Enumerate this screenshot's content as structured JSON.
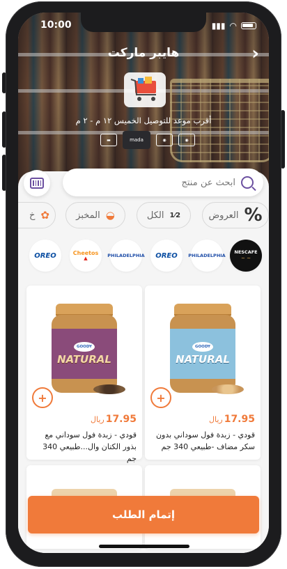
{
  "status_bar": {
    "time": "10:00"
  },
  "header": {
    "title": "هايبر ماركت",
    "back_icon": "chevron-right-icon",
    "delivery_text": "أقرب موعد للتوصيل الخميس ١٢ م - ٢ م",
    "payment_methods": [
      "card-icon",
      "mada-icon",
      "cash-icon",
      "cash-icon"
    ]
  },
  "search": {
    "placeholder": "ابحث عن منتج"
  },
  "categories": [
    {
      "label": "العروض",
      "icon": "percent-icon"
    },
    {
      "label": "الكل",
      "icon": "all-icon"
    },
    {
      "label": "المخبز",
      "icon": "bread-icon"
    },
    {
      "label": "خ",
      "icon": "produce-icon"
    }
  ],
  "brands": [
    "NESCAFE",
    "PHILADELPHIA",
    "OREO",
    "PHILADELPHIA",
    "Cheetos",
    "OREO"
  ],
  "products": [
    {
      "name": "قودي - زبدة فول سوداني بدون سكر مضاف -طبيعي 340 جم",
      "price": "17.95",
      "currency": "ريال",
      "label_text": "NATURAL",
      "brand": "GOODY"
    },
    {
      "name": "قودي - زبدة فول سوداني مع بذور الكتان وال...طبيعي 340 جم",
      "price": "17.95",
      "currency": "ريال",
      "label_text": "NATURAL",
      "brand": "GOODY"
    }
  ],
  "checkout": {
    "label": "إتمام الطلب"
  },
  "colors": {
    "accent": "#f07a3a",
    "brand_purple": "#6b4fa0"
  }
}
